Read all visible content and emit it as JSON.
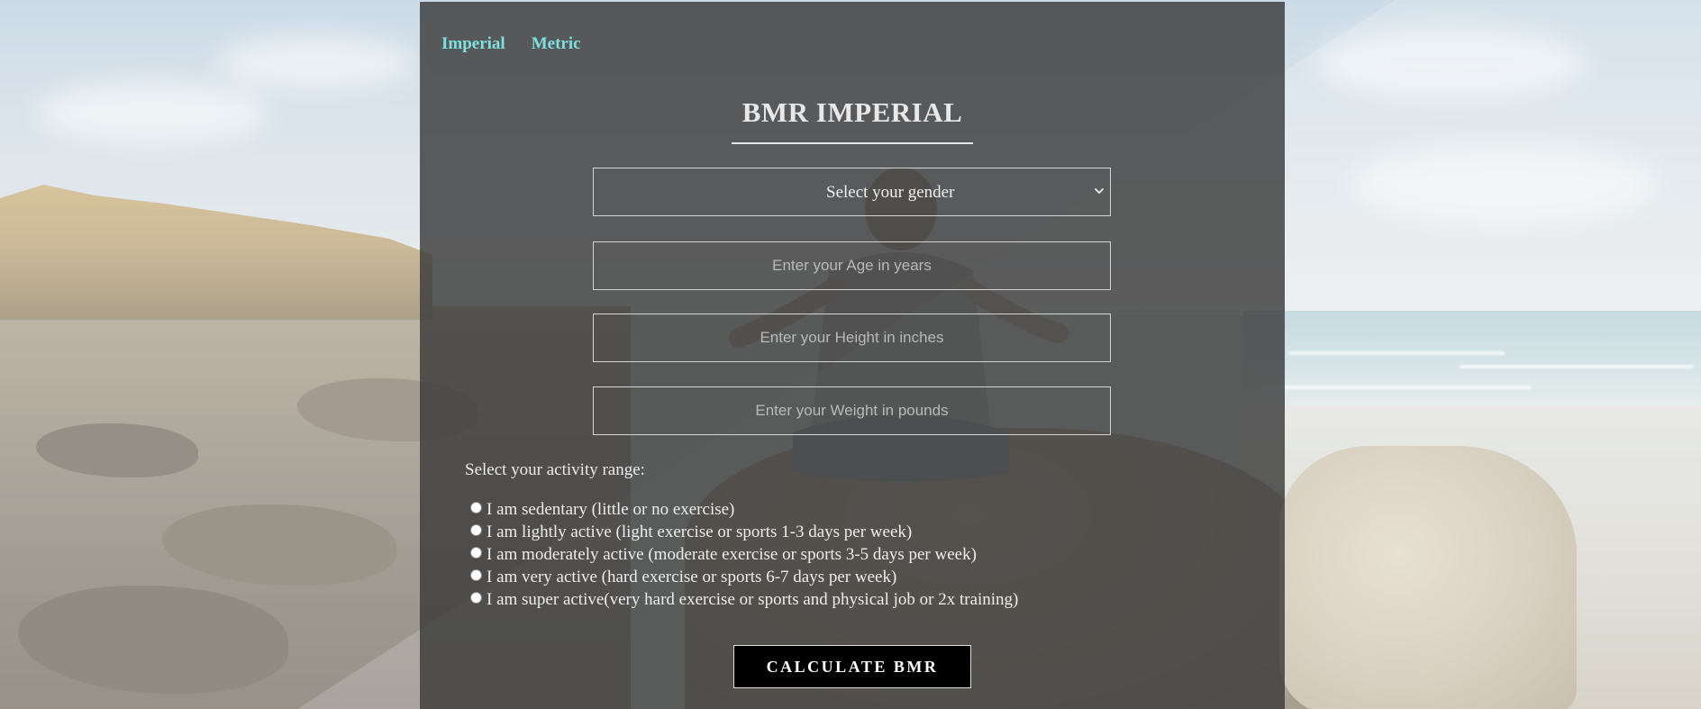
{
  "nav": {
    "imperial": "Imperial",
    "metric": "Metric"
  },
  "title": "BMR IMPERIAL",
  "gender_select": {
    "selected": "Select your gender"
  },
  "inputs": {
    "age_placeholder": "Enter your Age in years",
    "height_placeholder": "Enter your Height in inches",
    "weight_placeholder": "Enter your Weight in pounds"
  },
  "activity": {
    "label": "Select your activity range:",
    "options": [
      "I am sedentary (little or no exercise)",
      "I am lightly active (light exercise or sports 1-3 days per week)",
      "I am moderately active (moderate exercise or sports 3-5 days per week)",
      "I am very active (hard exercise or sports 6-7 days per week)",
      "I am super active(very hard exercise or sports and physical job or 2x training)"
    ]
  },
  "calculate_label": "CALCULATE BMR",
  "colors": {
    "nav_link": "#7fe0df",
    "panel": "#3a3a3a",
    "button_bg": "#000000"
  }
}
